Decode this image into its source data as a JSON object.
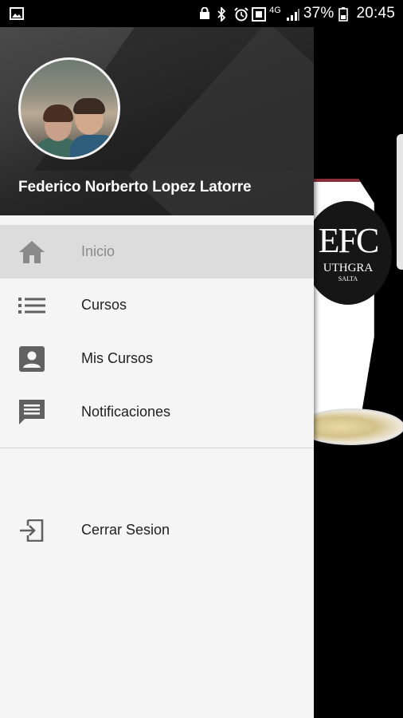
{
  "status_bar": {
    "battery": "37%",
    "time": "20:45",
    "network": "4G"
  },
  "drawer": {
    "user_name": "Federico Norberto Lopez Latorre",
    "menu": [
      {
        "label": "Inicio",
        "icon": "home-icon",
        "active": true
      },
      {
        "label": "Cursos",
        "icon": "list-icon",
        "active": false
      },
      {
        "label": "Mis Cursos",
        "icon": "account-box-icon",
        "active": false
      },
      {
        "label": "Notificaciones",
        "icon": "message-icon",
        "active": false
      }
    ],
    "logout": {
      "label": "Cerrar Sesion",
      "icon": "exit-icon"
    }
  },
  "background_app": {
    "logo_text": "EFC",
    "logo_sub": "UTHGRA",
    "logo_sub2": "SALTA"
  },
  "colors": {
    "drawer_bg": "#f5f5f5",
    "active_bg": "#dcdcdc",
    "icon_color": "#616161",
    "active_text": "#8a8a8a"
  }
}
